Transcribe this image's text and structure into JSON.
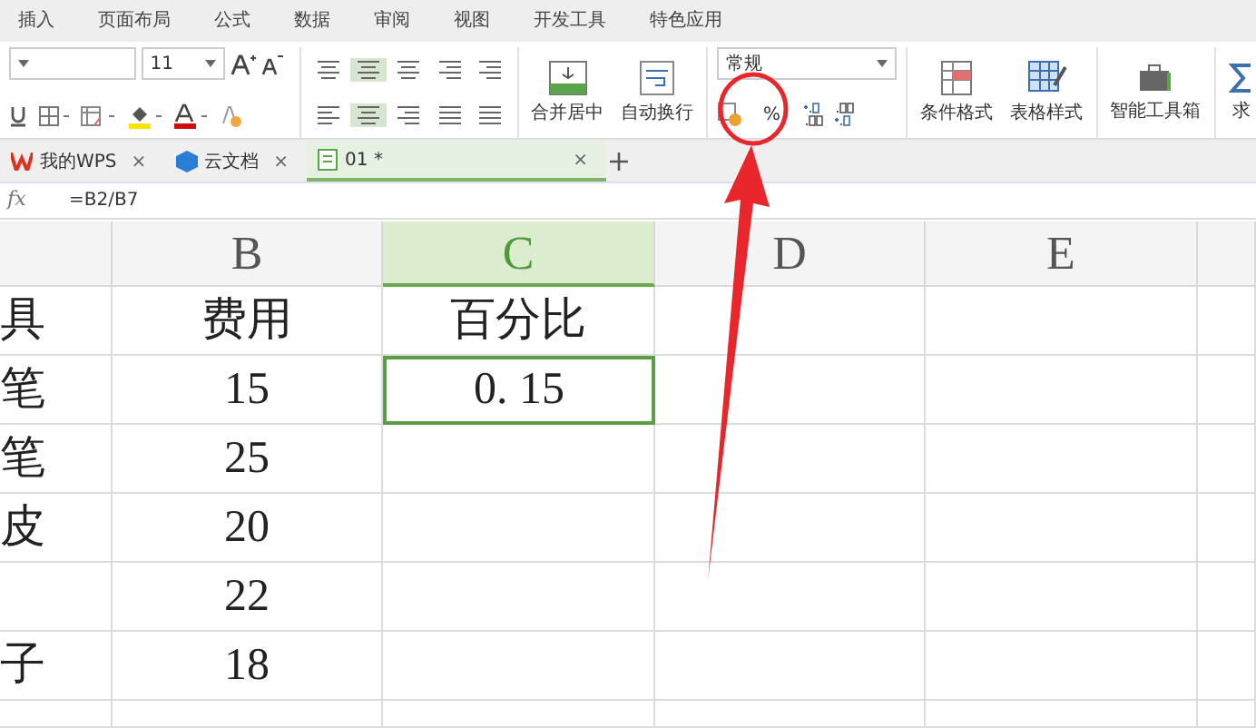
{
  "menu_tabs": [
    {
      "label": "插入"
    },
    {
      "label": "页面布局"
    },
    {
      "label": "公式"
    },
    {
      "label": "数据"
    },
    {
      "label": "审阅"
    },
    {
      "label": "视图"
    },
    {
      "label": "开发工具"
    },
    {
      "label": "特色应用"
    }
  ],
  "ribbon": {
    "font_size": "11",
    "merge_label": "合并居中",
    "wrap_label": "自动换行",
    "number_format": "常规",
    "percent_label": "%",
    "conditional_format": "条件格式",
    "table_style": "表格样式",
    "toolbox": "智能工具箱",
    "cut_label": "求"
  },
  "doc_tabs": [
    {
      "kind": "wps",
      "label": "我的WPS",
      "close_label": "×",
      "selected": false
    },
    {
      "kind": "cloud",
      "label": "云文档",
      "close_label": "×",
      "selected": false
    },
    {
      "kind": "sheet",
      "label": "01 *",
      "close_label": "×",
      "selected": true
    }
  ],
  "formula_bar": {
    "fx": "fx",
    "formula": "=B2/B7"
  },
  "columns": [
    {
      "selected": false
    },
    {
      "label": "B",
      "selected": false
    },
    {
      "label": "C",
      "selected": true
    },
    {
      "label": "D",
      "selected": false
    },
    {
      "label": "E",
      "selected": false
    }
  ],
  "rows": [
    {
      "cells": [
        {
          "text": "具",
          "selected": false
        },
        {
          "text": "费用",
          "selected": false
        },
        {
          "text": "百分比",
          "selected": false
        }
      ]
    },
    {
      "cells": [
        {
          "text": "笔",
          "selected": false
        },
        {
          "text": "15",
          "selected": false
        },
        {
          "text": "0. 15",
          "selected": true
        }
      ]
    },
    {
      "cells": [
        {
          "text": "笔",
          "selected": false
        },
        {
          "text": "25",
          "selected": false
        },
        {
          "selected": false
        }
      ]
    },
    {
      "cells": [
        {
          "text": "皮",
          "selected": false
        },
        {
          "text": "20",
          "selected": false
        },
        {
          "selected": false
        }
      ]
    },
    {
      "cells": [
        {
          "selected": false
        },
        {
          "text": "22",
          "selected": false
        },
        {
          "selected": false
        }
      ]
    },
    {
      "cells": [
        {
          "text": "子",
          "selected": false
        },
        {
          "text": "18",
          "selected": false
        },
        {
          "selected": false
        }
      ]
    }
  ]
}
